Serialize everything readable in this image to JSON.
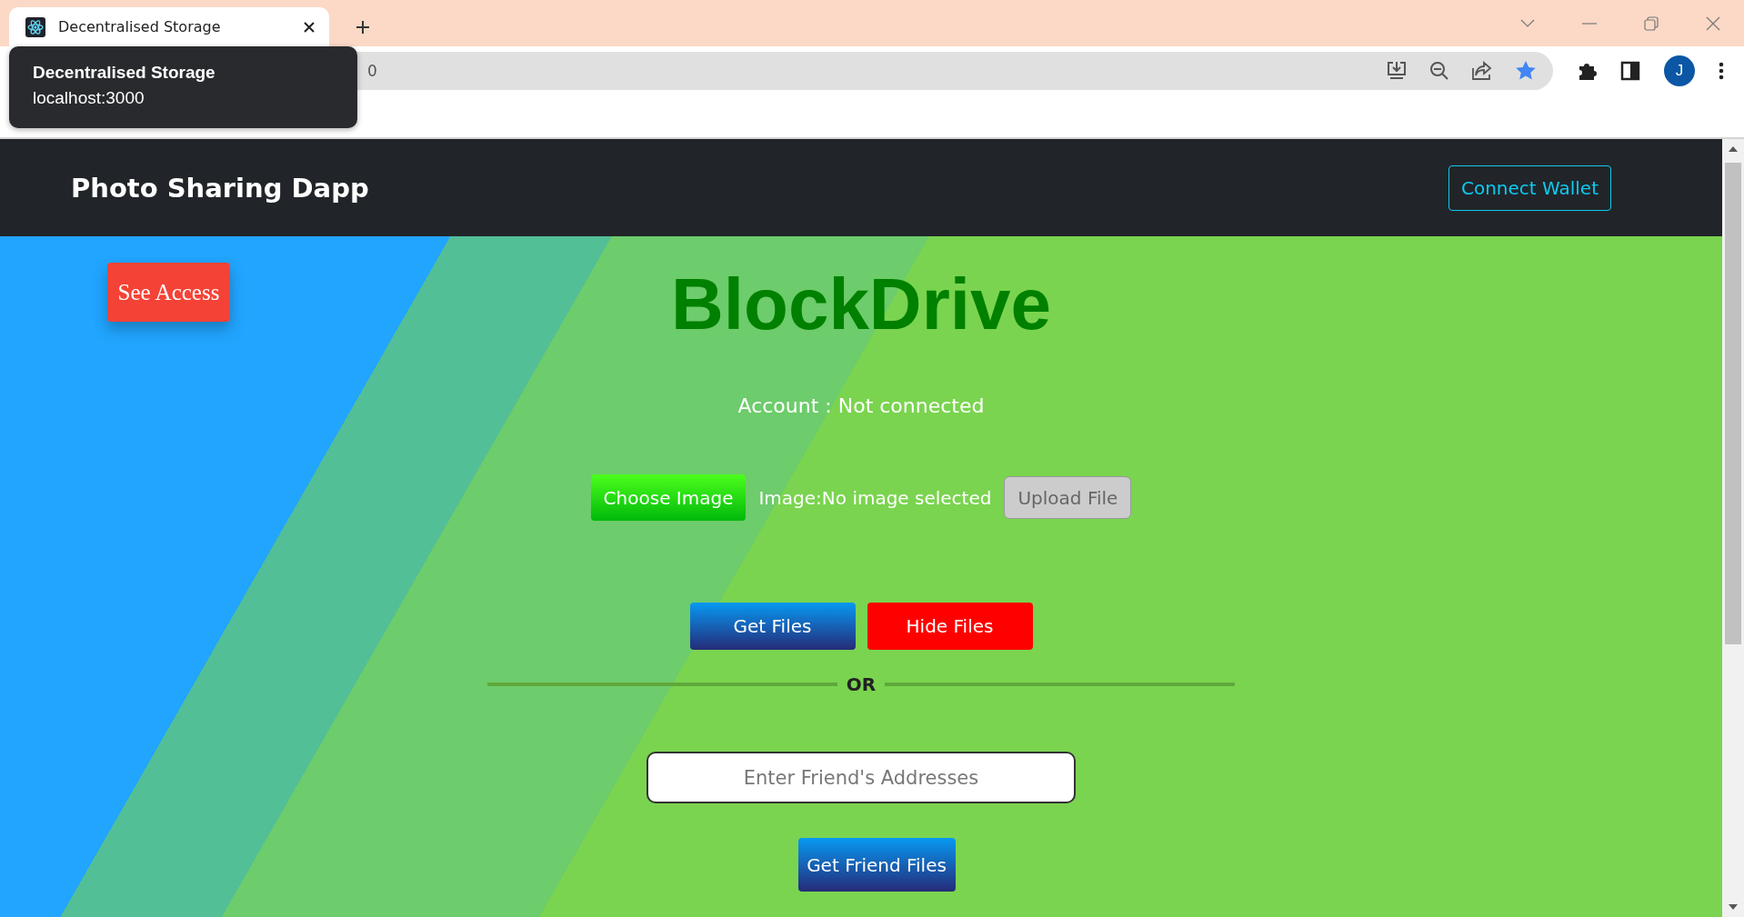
{
  "browser": {
    "tabs": [
      {
        "title": "Decentralised Storage",
        "selected": true
      }
    ],
    "address_visible": "0",
    "bookmarked": true,
    "avatar_initial": "J"
  },
  "tooltip": {
    "title": "Decentralised Storage",
    "url": "localhost:3000"
  },
  "navbar": {
    "brand": "Photo Sharing Dapp",
    "connect_button": "Connect Wallet"
  },
  "see_access_button": "See Access",
  "heading": "BlockDrive",
  "account": "Account : Not connected",
  "upload": {
    "choose_button": "Choose Image",
    "file_status": "Image:No image selected",
    "upload_button": {
      "label": "Upload File",
      "disabled": true
    }
  },
  "files_buttons": [
    {
      "label": "Get Files",
      "kind": "primary"
    },
    {
      "label": "Hide Files",
      "kind": "danger"
    }
  ],
  "divider_label": "OR",
  "friend_input": {
    "placeholder": "Enter Friend's Addresses"
  },
  "friend_button": "Get Friend Files"
}
